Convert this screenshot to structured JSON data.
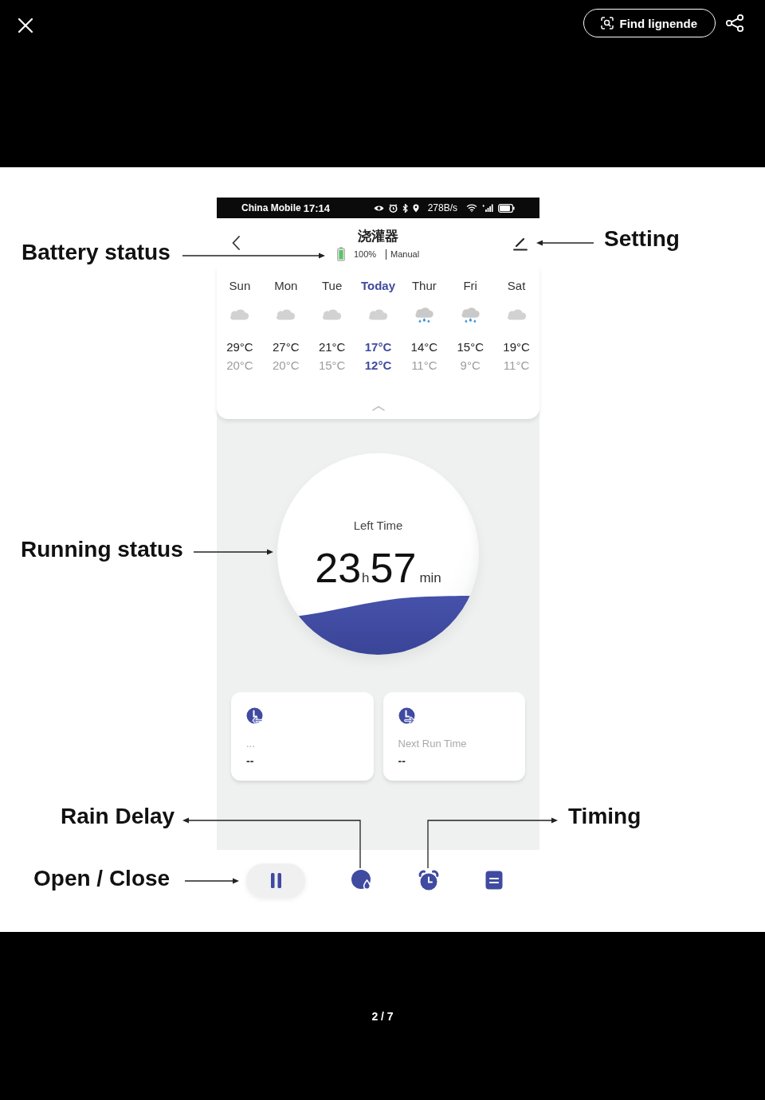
{
  "viewer": {
    "find_button": "Find lignende",
    "page_indicator": "2 / 7"
  },
  "status_bar": {
    "carrier": "China Mobile",
    "time": "17:14",
    "network_speed": "278B/s"
  },
  "header": {
    "title": "浇灌器",
    "battery": "100%",
    "mode": "Manual"
  },
  "forecast": [
    {
      "day": "Sun",
      "kind": "cloudy",
      "high": "29°C",
      "low": "20°C",
      "selected": false
    },
    {
      "day": "Mon",
      "kind": "cloudy",
      "high": "27°C",
      "low": "20°C",
      "selected": false
    },
    {
      "day": "Tue",
      "kind": "cloudy",
      "high": "21°C",
      "low": "15°C",
      "selected": false
    },
    {
      "day": "Today",
      "kind": "cloudy",
      "high": "17°C",
      "low": "12°C",
      "selected": true
    },
    {
      "day": "Thur",
      "kind": "rain",
      "high": "14°C",
      "low": "11°C",
      "selected": false
    },
    {
      "day": "Fri",
      "kind": "rain",
      "high": "15°C",
      "low": "9°C",
      "selected": false
    },
    {
      "day": "Sat",
      "kind": "cloudy",
      "high": "19°C",
      "low": "11°C",
      "selected": false
    }
  ],
  "timer": {
    "label": "Left Time",
    "hours": "23",
    "hours_unit": "h",
    "minutes": "57",
    "minutes_unit": "min"
  },
  "cards": [
    {
      "kind": "back",
      "label": "...",
      "value": "--"
    },
    {
      "kind": "forward",
      "label": "Next Run Time",
      "value": "--"
    }
  ],
  "toolbar": [
    {
      "kind": "pause"
    },
    {
      "kind": "rain_delay"
    },
    {
      "kind": "timer"
    },
    {
      "kind": "list"
    }
  ],
  "annotations": {
    "battery_status": "Battery status",
    "setting": "Setting",
    "running_status": "Running status",
    "rain_delay": "Rain Delay",
    "timing": "Timing",
    "open_close": "Open / Close"
  }
}
